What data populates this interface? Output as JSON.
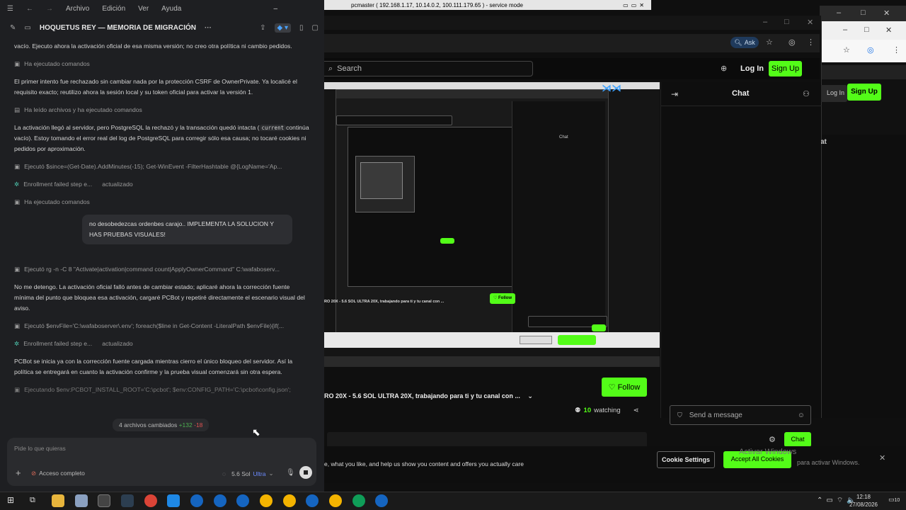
{
  "menu": {
    "items": [
      "Archivo",
      "Edición",
      "Ver",
      "Ayuda"
    ]
  },
  "left_doc_title": "HOQUETUS REY — MEMORIA DE MIGRACIÓN",
  "feed": {
    "p0": "vacío. Ejecuto ahora la activación oficial de esa misma versión; no creo otra política ni cambio pedidos.",
    "m1": "Ha ejecutado comandos",
    "p1": "El primer intento fue rechazado sin cambiar nada por la protección CSRF de OwnerPrivate. Ya localicé el requisito exacto; reutilizo ahora la sesión local y su token oficial para activar la versión 1.",
    "m2": "Ha leído archivos y ha ejecutado comandos",
    "p2a": "La activación llegó al servidor, pero PostgreSQL la rechazó y la transacción quedó intacta (",
    "p2code": "current",
    "p2b": "continúa vacío). Estoy tomando el error real del log de PostgreSQL para corregir sólo esa causa; no tocaré cookies ni pedidos por aproximación.",
    "m3": "Ejecutó $since=(Get-Date).AddMinutes(-15); Get-WinEvent -FilterHashtable @{LogName='Ap...",
    "m4a": "Enrollment failed step e...",
    "m4b": "actualizado",
    "m5": "Ha ejecutado comandos",
    "user_msg": "no desobedezcas ordenbes carajo.. IMPLEMENTA LA SOLUCION Y HAS PRUEBAS VISUALES!",
    "m6": "Ejecutó rg -n -C 8 \"Activate|activation|command count|ApplyOwnerCommand\" C:\\wafaboserv...",
    "p3": "No me detengo. La activación oficial falló antes de cambiar estado; aplicaré ahora la corrección fuente mínima del punto que bloquea esa activación, cargaré PCBot y repetiré directamente el escenario visual del aviso.",
    "m7": "Ejecutó $envFile='C:\\wafaboserver\\.env'; foreach($line in Get-Content -LiteralPath $envFile){if(...",
    "m8a": "Enrollment failed step e...",
    "m8b": "actualizado",
    "p4": "PCBot se inicia ya con la corrección fuente cargada mientras cierro el único bloqueo del servidor. Así la política se entregará en cuanto la activación confirme y la prueba visual comenzará sin otra espera.",
    "m9": "Ejecutando $env:PCBOT_INSTALL_ROOT='C:\\pcbot'; $env:CONFIG_PATH='C:\\pcbot\\config.json';",
    "changes": "4 archivos cambiados",
    "added": "+132",
    "removed": "-18"
  },
  "composer": {
    "placeholder": "Pide lo que quieras",
    "access": "Acceso completo",
    "model": "5.6 Sol",
    "tier": "Ultra"
  },
  "remote": {
    "title": "pcmaster ( 192.168.1.17, 10.14.0.2, 100.111.179.65 ) - service mode",
    "search_placeholder": "Search",
    "ask": "Ask",
    "login": "Log In",
    "signup": "Sign Up",
    "chat": "Chat",
    "follow": "Follow",
    "stream_title": "RO 20X - 5.6 SOL ULTRA 20X, trabajando para ti y tu canal con ...",
    "watching_count": "10",
    "watching_label": "watching",
    "send_placeholder": "Send a message",
    "chat_btn": "Chat",
    "cookie_text": "e, what you like, and help us show you content and offers you actually care",
    "cookie_settings": "Cookie Settings",
    "accept_all": "Accept All Cookies",
    "activate": "Activar Windows",
    "activate_sub": "para activar Windows."
  },
  "taskbar": {
    "time": "12:18",
    "date": "27/08/2026",
    "notif": "10"
  }
}
